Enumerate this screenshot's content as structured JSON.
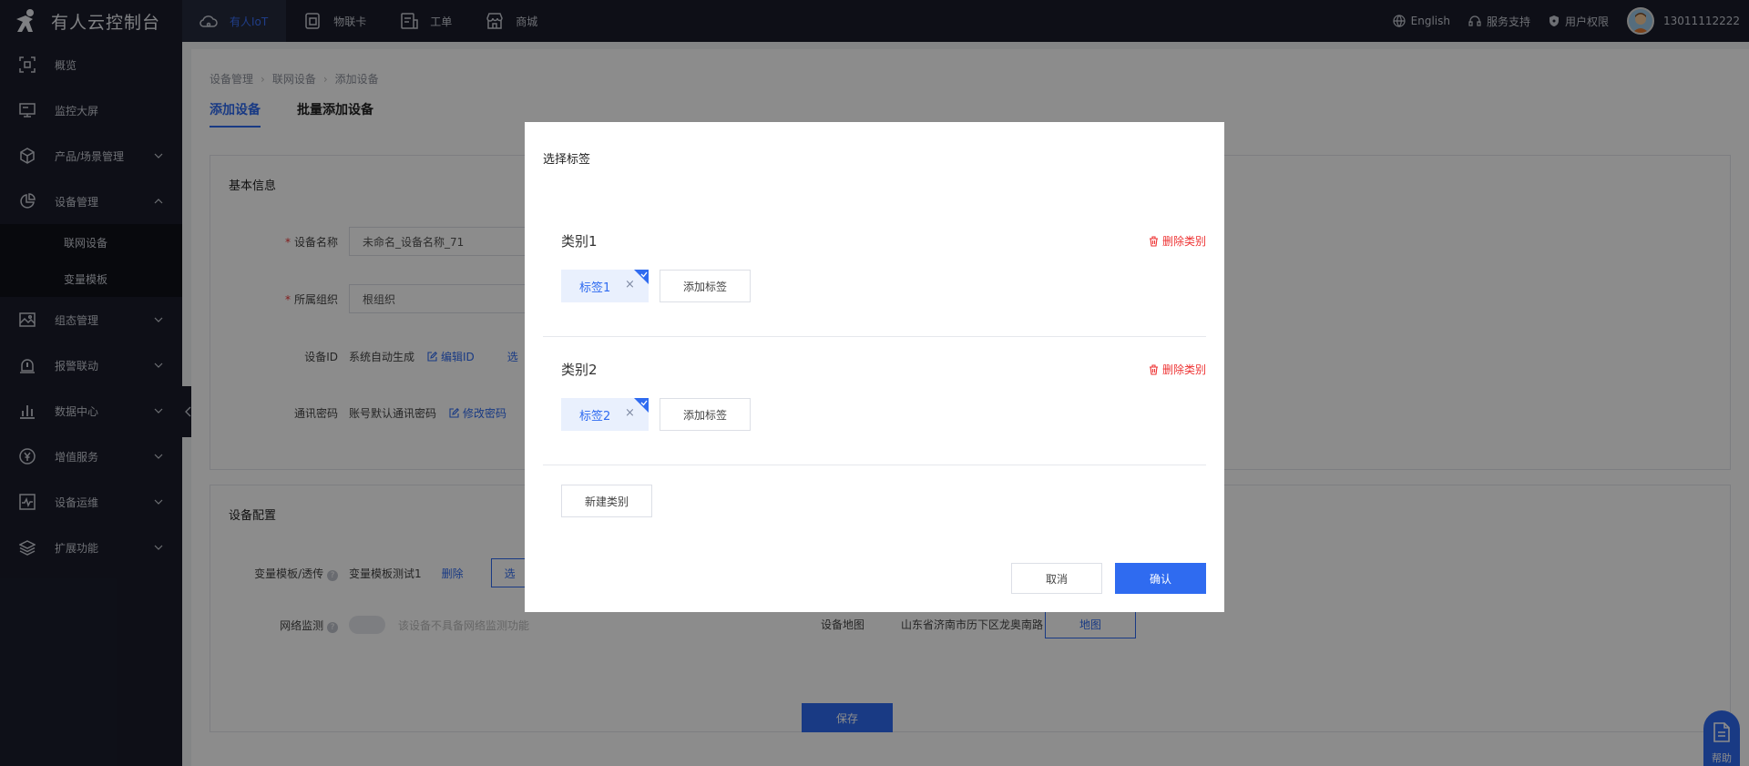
{
  "app": {
    "title": "有人云控制台"
  },
  "topnav": [
    {
      "label": "有人IoT",
      "icon": "cloud-icon",
      "active": true
    },
    {
      "label": "物联卡",
      "icon": "sim-card-icon"
    },
    {
      "label": "工单",
      "icon": "ticket-icon"
    },
    {
      "label": "商城",
      "icon": "store-icon"
    }
  ],
  "topright": {
    "language": "English",
    "support": "服务支持",
    "permission": "用户权限",
    "user": "13011112222"
  },
  "sidebar": {
    "items": [
      {
        "label": "概览",
        "icon": "overview-icon"
      },
      {
        "label": "监控大屏",
        "icon": "monitor-icon"
      },
      {
        "label": "产品/场景管理",
        "icon": "cube-icon"
      },
      {
        "label": "设备管理",
        "icon": "pie-chart-icon",
        "expanded": true
      },
      {
        "label": "组态管理",
        "icon": "image-icon"
      },
      {
        "label": "报警联动",
        "icon": "alarm-icon"
      },
      {
        "label": "数据中心",
        "icon": "bar-chart-icon"
      },
      {
        "label": "增值服务",
        "icon": "yen-icon"
      },
      {
        "label": "设备运维",
        "icon": "activity-icon"
      },
      {
        "label": "扩展功能",
        "icon": "layers-icon"
      }
    ],
    "subitems": [
      "联网设备",
      "变量模板"
    ]
  },
  "breadcrumb": [
    "设备管理",
    "联网设备",
    "添加设备"
  ],
  "tabs": [
    "添加设备",
    "批量添加设备"
  ],
  "basic": {
    "title": "基本信息",
    "name_label": "设备名称",
    "name_value": "未命名_设备名称_71",
    "org_label": "所属组织",
    "org_value": "根组织",
    "id_label": "设备ID",
    "id_value": "系统自动生成",
    "id_edit": "编辑ID",
    "id_extra": "选",
    "pwd_label": "通讯密码",
    "pwd_value": "账号默认通讯密码",
    "pwd_edit": "修改密码"
  },
  "config": {
    "title": "设备配置",
    "tpl_label": "变量模板/透传",
    "tpl_value": "变量模板测试1",
    "tpl_delete": "删除",
    "tpl_btn": "选",
    "net_label": "网络监测",
    "net_desc": "该设备不具备网络监测功能",
    "map_label": "设备地图",
    "map_value": "山东省济南市历下区龙奥南路",
    "map_btn": "地图"
  },
  "save_label": "保存",
  "modal": {
    "title": "选择标签",
    "categories": [
      {
        "name": "类别1",
        "delete": "删除类别",
        "tags": [
          "标签1"
        ],
        "add": "添加标签"
      },
      {
        "name": "类别2",
        "delete": "删除类别",
        "tags": [
          "标签2"
        ],
        "add": "添加标签"
      }
    ],
    "new_category": "新建类别",
    "cancel": "取消",
    "confirm": "确认"
  },
  "help_label": "帮助",
  "colors": {
    "primary": "#2f6bf0",
    "danger": "#e33333",
    "topbar": "#1a1d2b"
  }
}
